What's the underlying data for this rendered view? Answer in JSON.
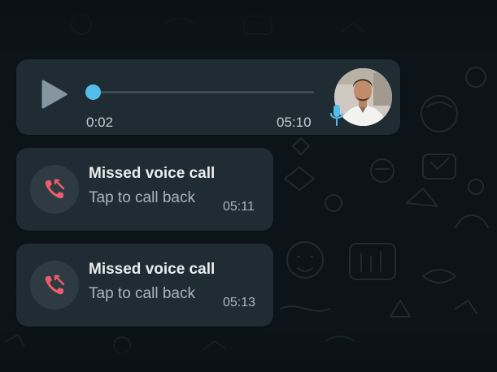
{
  "colors": {
    "background": "#0d1419",
    "bubble": "#202c33",
    "accent": "#53bdeb",
    "missed": "#ea5e6b"
  },
  "voice_message": {
    "elapsed": "0:02",
    "time": "05:10",
    "progress": 0.02,
    "icons": [
      "play-icon",
      "microphone-icon"
    ]
  },
  "calls": [
    {
      "title": "Missed voice call",
      "subtitle": "Tap to call back",
      "time": "05:11",
      "icon": "missed-call-icon"
    },
    {
      "title": "Missed voice call",
      "subtitle": "Tap to call back",
      "time": "05:13",
      "icon": "missed-call-icon"
    }
  ]
}
